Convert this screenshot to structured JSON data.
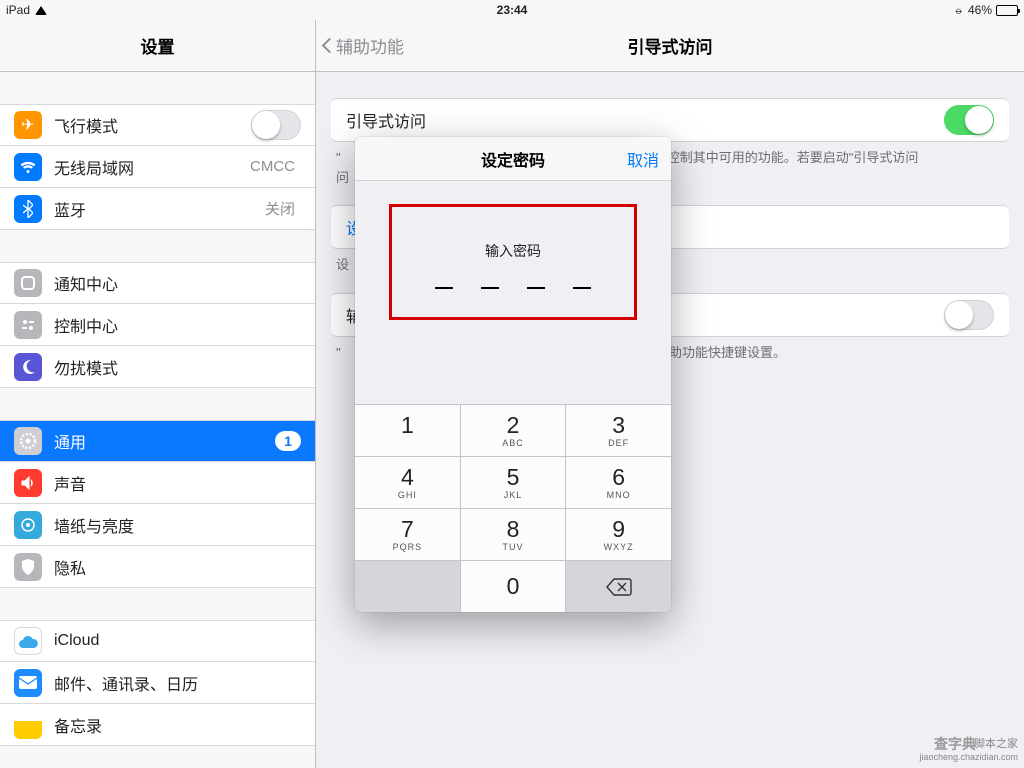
{
  "status": {
    "device": "iPad",
    "time": "23:44",
    "battery_pct": "46%",
    "orientation_lock": "⦵"
  },
  "sidebar": {
    "title": "设置",
    "airplane": {
      "label": "飞行模式"
    },
    "wifi": {
      "label": "无线局域网",
      "value": "CMCC"
    },
    "bt": {
      "label": "蓝牙",
      "value": "关闭"
    },
    "notif": {
      "label": "通知中心"
    },
    "control": {
      "label": "控制中心"
    },
    "dnd": {
      "label": "勿扰模式"
    },
    "general": {
      "label": "通用",
      "badge": "1"
    },
    "sounds": {
      "label": "声音"
    },
    "wallpaper": {
      "label": "墙纸与亮度"
    },
    "privacy": {
      "label": "隐私"
    },
    "icloud": {
      "label": "iCloud"
    },
    "mail": {
      "label": "邮件、通讯录、日历"
    },
    "notes": {
      "label": "备忘录"
    }
  },
  "detail": {
    "back": "辅助功能",
    "title": "引导式访问",
    "row1": "引导式访问",
    "desc1_tail": "您控制其中可用的功能。若要启动\"引导式访问",
    "row2_frag": "设",
    "desc2_frag": "设",
    "row3_frag": "辅",
    "desc3_tail": "启用的辅助功能快捷键设置。"
  },
  "modal": {
    "title": "设定密码",
    "cancel": "取消",
    "prompt": "输入密码",
    "keys": [
      {
        "n": "1",
        "l": ""
      },
      {
        "n": "2",
        "l": "ABC"
      },
      {
        "n": "3",
        "l": "DEF"
      },
      {
        "n": "4",
        "l": "GHI"
      },
      {
        "n": "5",
        "l": "JKL"
      },
      {
        "n": "6",
        "l": "MNO"
      },
      {
        "n": "7",
        "l": "PQRS"
      },
      {
        "n": "8",
        "l": "TUV"
      },
      {
        "n": "9",
        "l": "WXYZ"
      },
      {
        "n": "",
        "l": ""
      },
      {
        "n": "0",
        "l": ""
      },
      {
        "n": "⌫",
        "l": ""
      }
    ]
  },
  "watermark": {
    "a": "查字典",
    "b": "脚本之家",
    "c": "jiaocheng.chazidian.com"
  }
}
